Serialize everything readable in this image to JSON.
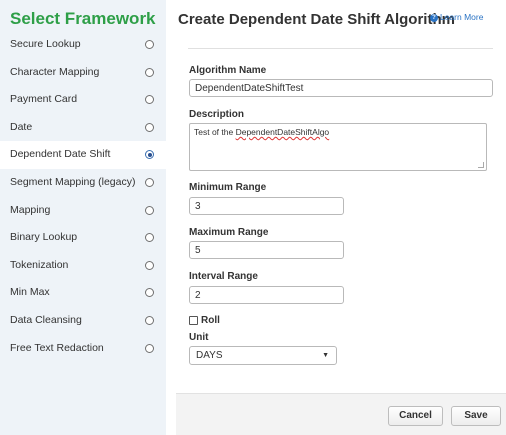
{
  "sidebar": {
    "title": "Select Framework",
    "items": [
      {
        "label": "Secure Lookup",
        "selected": false
      },
      {
        "label": "Character Mapping",
        "selected": false
      },
      {
        "label": "Payment Card",
        "selected": false
      },
      {
        "label": "Date",
        "selected": false
      },
      {
        "label": "Dependent Date Shift",
        "selected": true
      },
      {
        "label": "Segment Mapping (legacy)",
        "selected": false
      },
      {
        "label": "Mapping",
        "selected": false
      },
      {
        "label": "Binary Lookup",
        "selected": false
      },
      {
        "label": "Tokenization",
        "selected": false
      },
      {
        "label": "Min Max",
        "selected": false
      },
      {
        "label": "Data Cleansing",
        "selected": false
      },
      {
        "label": "Free Text Redaction",
        "selected": false
      }
    ]
  },
  "header": {
    "title": "Create Dependent Date Shift Algorithm",
    "learn_more": "Learn More",
    "info_icon": "info-icon"
  },
  "form": {
    "name_label": "Algorithm Name",
    "name_value": "DependentDateShiftTest",
    "description_label": "Description",
    "description_prefix": "Test of the ",
    "description_misspelled": "DependentDateShiftAlgo",
    "min_label": "Minimum Range",
    "min_value": "3",
    "max_label": "Maximum Range",
    "max_value": "5",
    "interval_label": "Interval Range",
    "interval_value": "2",
    "roll_label": "Roll",
    "roll_checked": false,
    "unit_label": "Unit",
    "unit_value": "DAYS"
  },
  "footer": {
    "cancel_label": "Cancel",
    "save_label": "Save"
  },
  "colors": {
    "sidebar_title": "#2e9f48",
    "link": "#2a73c4",
    "sidebar_bg": "#eef3f8"
  }
}
